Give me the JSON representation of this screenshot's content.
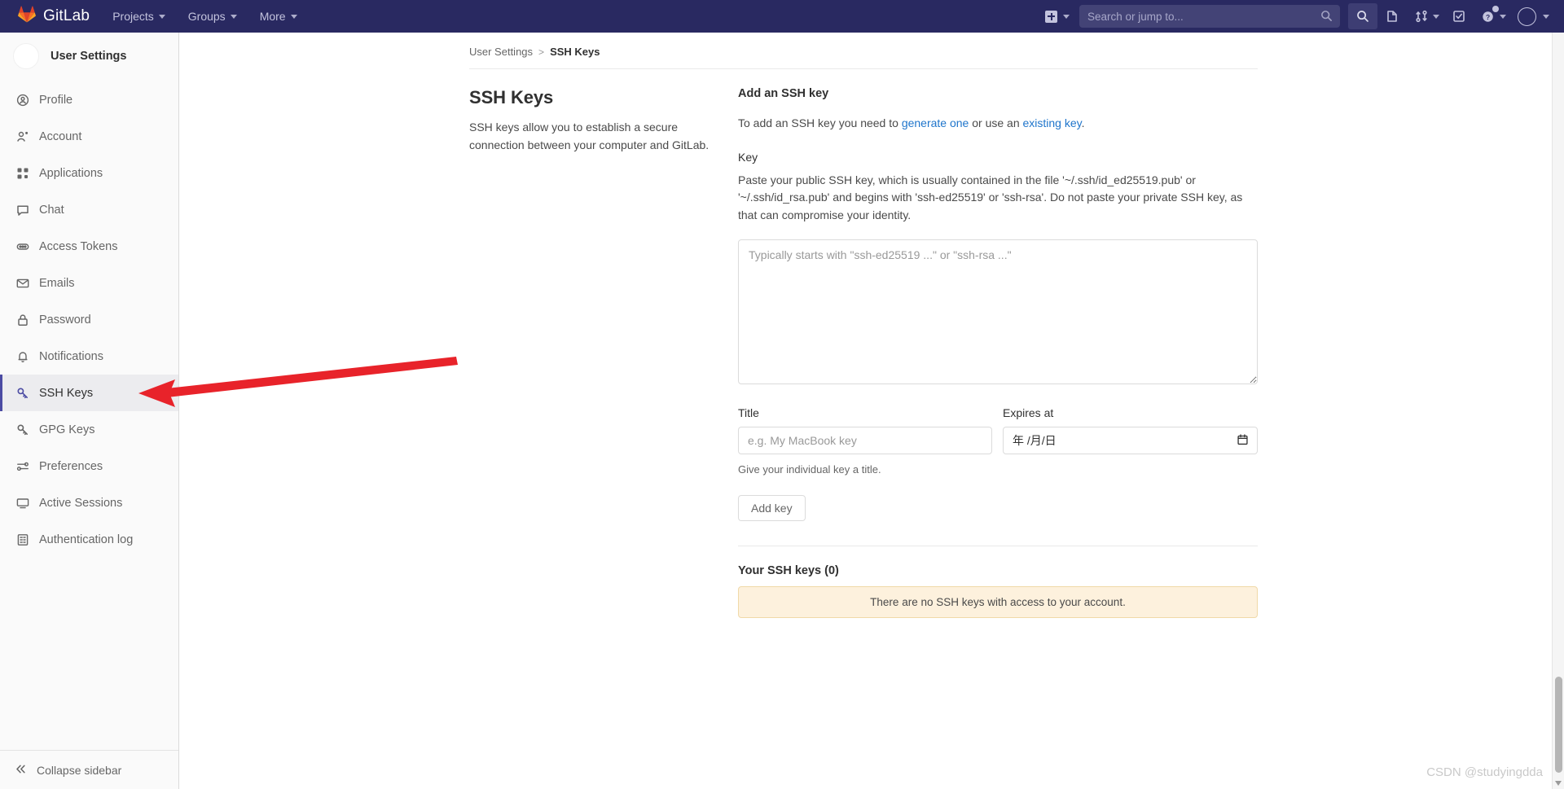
{
  "navbar": {
    "brand": "GitLab",
    "brand_icon": "gitlab-logo-icon",
    "items": [
      {
        "label": "Projects",
        "icon": "chevron-down-icon"
      },
      {
        "label": "Groups",
        "icon": "chevron-down-icon"
      },
      {
        "label": "More",
        "icon": "chevron-down-icon"
      }
    ],
    "new_icon": "plus-square-icon",
    "search": {
      "placeholder": "Search or jump to...",
      "value": "",
      "icon": "search-icon"
    },
    "right_icons": [
      {
        "name": "search-icon"
      },
      {
        "name": "issues-icon"
      },
      {
        "name": "merge-requests-icon"
      },
      {
        "name": "todos-icon"
      },
      {
        "name": "help-icon"
      },
      {
        "name": "user-avatar-icon"
      }
    ],
    "bg_color": "#292961",
    "text_color": "#c3c3dd"
  },
  "sidebar": {
    "user_label": "User Settings",
    "avatar_icon": "user-avatar-icon",
    "active_item": "SSH Keys",
    "active_accent": "#4b4ba3",
    "items": [
      {
        "label": "Profile",
        "icon": "profile-icon"
      },
      {
        "label": "Account",
        "icon": "account-gear-icon"
      },
      {
        "label": "Applications",
        "icon": "applications-grid-icon"
      },
      {
        "label": "Chat",
        "icon": "chat-bubble-icon"
      },
      {
        "label": "Access Tokens",
        "icon": "token-icon"
      },
      {
        "label": "Emails",
        "icon": "envelope-icon"
      },
      {
        "label": "Password",
        "icon": "lock-icon"
      },
      {
        "label": "Notifications",
        "icon": "bell-icon"
      },
      {
        "label": "SSH Keys",
        "icon": "key-icon"
      },
      {
        "label": "GPG Keys",
        "icon": "key-icon"
      },
      {
        "label": "Preferences",
        "icon": "sliders-icon"
      },
      {
        "label": "Active Sessions",
        "icon": "monitor-icon"
      },
      {
        "label": "Authentication log",
        "icon": "log-list-icon"
      }
    ],
    "collapse": {
      "label": "Collapse sidebar",
      "icon": "double-chevron-left-icon"
    }
  },
  "breadcrumb": {
    "root": "User Settings",
    "separator": ">",
    "current": "SSH Keys"
  },
  "page": {
    "title": "SSH Keys",
    "description": "SSH keys allow you to establish a secure connection between your computer and GitLab."
  },
  "form": {
    "section_title": "Add an SSH key",
    "intro_prefix": "To add an SSH key you need to ",
    "intro_link1": "generate one",
    "intro_middle": " or use an ",
    "intro_link2": "existing key",
    "intro_suffix": ".",
    "key_label": "Key",
    "key_hint": "Paste your public SSH key, which is usually contained in the file '~/.ssh/id_ed25519.pub' or '~/.ssh/id_rsa.pub' and begins with 'ssh-ed25519' or 'ssh-rsa'. Do not paste your private SSH key, as that can compromise your identity.",
    "key_placeholder": "Typically starts with \"ssh-ed25519 ...\" or \"ssh-rsa ...\"",
    "key_value": "",
    "title_label": "Title",
    "title_placeholder": "e.g. My MacBook key",
    "title_value": "",
    "title_helper": "Give your individual key a title.",
    "expires_label": "Expires at",
    "expires_placeholder": "年 /月/日",
    "expires_value": "",
    "expires_icon": "calendar-icon",
    "submit_label": "Add key",
    "link_color": "#1f75cb"
  },
  "keys_list": {
    "heading": "Your SSH keys (0)",
    "empty_message": "There are no SSH keys with access to your account.",
    "empty_bg": "#fdf1dd",
    "empty_border": "#f0d9a8"
  },
  "annotation": {
    "arrow_color": "#e8232a",
    "points_to": "SSH Keys"
  },
  "watermark": {
    "text": "CSDN @studyingdda"
  }
}
